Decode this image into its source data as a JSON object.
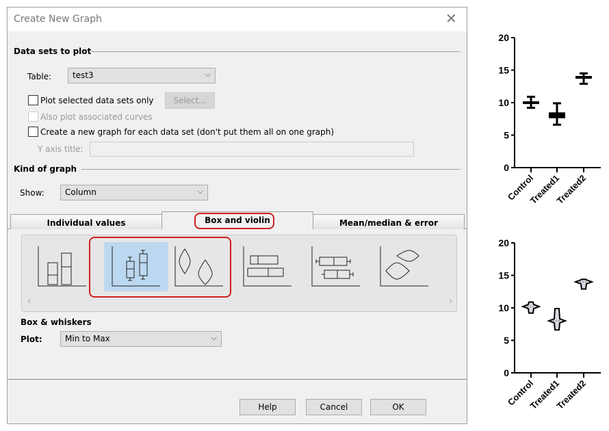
{
  "dialog": {
    "title": "Create New Graph",
    "data_sets_section": "Data sets to plot",
    "table_label": "Table:",
    "table_value": "test3",
    "plot_selected_label": "Plot selected data sets only",
    "plot_selected_checked": false,
    "select_button": "Select...",
    "also_plot_label": "Also plot associated curves",
    "new_graph_label": "Create a new graph for each data set (don't put them all on one graph)",
    "new_graph_checked": false,
    "y_axis_title_label": "Y axis title:",
    "y_axis_title_value": "",
    "kind_section": "Kind of graph",
    "show_label": "Show:",
    "show_value": "Column",
    "tabs": [
      {
        "label": "Individual values",
        "active": false
      },
      {
        "label": "Box and violin",
        "active": true
      },
      {
        "label": "Mean/median & error",
        "active": false
      }
    ],
    "gallery_icons": [
      "floating-bars-icon",
      "box-whiskers-icon",
      "violin-icon",
      "horizontal-bars-icon",
      "horizontal-box-whiskers-icon",
      "horizontal-violin-icon"
    ],
    "gallery_selected": 1,
    "box_section": "Box & whiskers",
    "plot_label": "Plot:",
    "plot_value": "Min to Max",
    "buttons": {
      "help": "Help",
      "cancel": "Cancel",
      "ok": "OK"
    },
    "highlight_color": "#d21e1e",
    "selection_color": "#bcd8f0"
  },
  "chart_data": [
    {
      "type": "box",
      "categories": [
        "Control",
        "Treated1",
        "Treated2"
      ],
      "yticks": [
        "0",
        "5",
        "10",
        "15",
        "20"
      ],
      "ylim": [
        0,
        20
      ],
      "series": [
        {
          "min": 9.2,
          "q1": 9.8,
          "median": 10.0,
          "q3": 10.2,
          "max": 10.9
        },
        {
          "min": 6.6,
          "q1": 7.6,
          "median": 8.0,
          "q3": 8.5,
          "max": 9.9
        },
        {
          "min": 12.9,
          "q1": 13.7,
          "median": 13.9,
          "q3": 14.1,
          "max": 14.5
        }
      ]
    },
    {
      "type": "violin",
      "categories": [
        "Control",
        "Treated1",
        "Treated2"
      ],
      "yticks": [
        "0",
        "5",
        "10",
        "15",
        "20"
      ],
      "ylim": [
        0,
        20
      ],
      "series": [
        {
          "min": 9.2,
          "median": 10.2,
          "max": 10.9
        },
        {
          "min": 6.6,
          "median": 8.0,
          "max": 9.9
        },
        {
          "min": 12.9,
          "median": 14.0,
          "max": 14.4
        }
      ],
      "fill": "#d8d8e0"
    }
  ]
}
